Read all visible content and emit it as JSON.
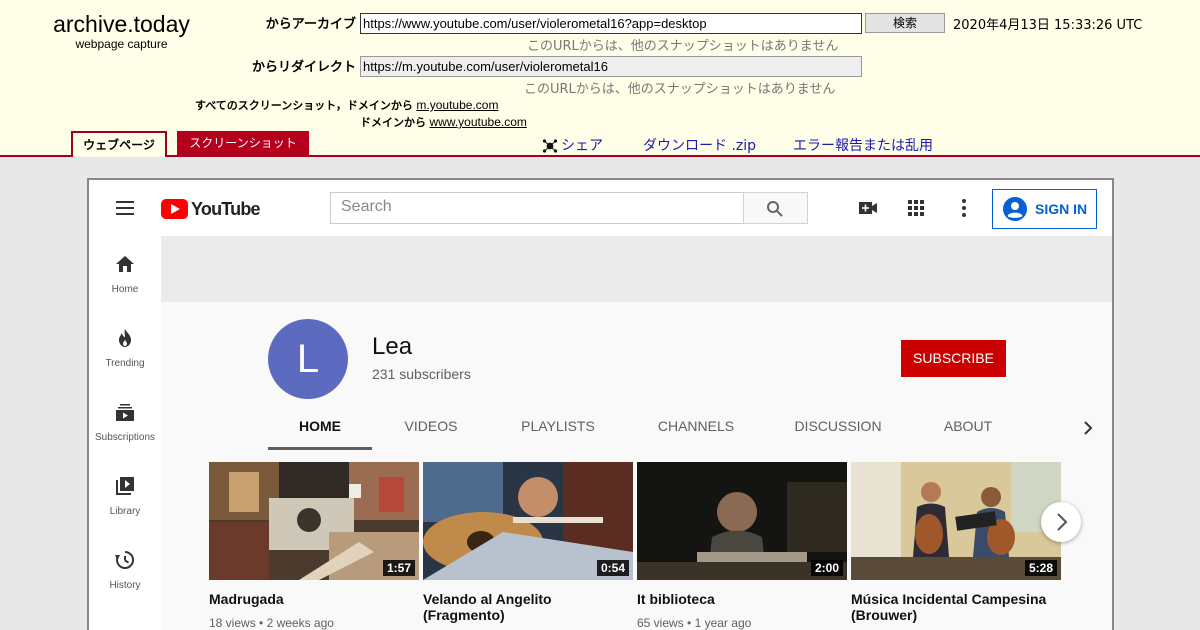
{
  "archive": {
    "brand_title": "archive.today",
    "brand_subtitle": "webpage capture",
    "archive_from_label": "からアーカイブ",
    "archive_url": "https://www.youtube.com/user/violerometal16?app=desktop",
    "search_button": "検索",
    "timestamp": "2020年4月13日 15:33:26 UTC",
    "no_snapshots_1": "このURLからは、他のスナップショットはありません",
    "redirect_label": "からリダイレクト",
    "redirect_url": "https://m.youtube.com/user/violerometal16",
    "no_snapshots_2": "このURLからは、他のスナップショットはありません",
    "all_screenshots_prefix": "すべてのスクリーンショット，ドメインから",
    "domain_1": "m.youtube.com",
    "domain_prefix_2": "ドメインから",
    "domain_2": "www.youtube.com",
    "tab_webpage": "ウェブページ",
    "tab_screenshot": "スクリーンショット",
    "share": "シェア",
    "download": "ダウンロード .zip",
    "report": "エラー報告または乱用"
  },
  "youtube": {
    "logo_text": "YouTube",
    "search_placeholder": "Search",
    "sign_in": "SIGN IN",
    "sidebar": [
      {
        "label": "Home",
        "icon": "home-icon"
      },
      {
        "label": "Trending",
        "icon": "flame-icon"
      },
      {
        "label": "Subscriptions",
        "icon": "subscriptions-icon"
      },
      {
        "label": "Library",
        "icon": "library-icon"
      },
      {
        "label": "History",
        "icon": "history-icon"
      }
    ],
    "channel": {
      "avatar_letter": "L",
      "name": "Lea",
      "subscribers": "231 subscribers",
      "subscribe_button": "SUBSCRIBE"
    },
    "tabs": [
      "HOME",
      "VIDEOS",
      "PLAYLISTS",
      "CHANNELS",
      "DISCUSSION",
      "ABOUT"
    ],
    "active_tab": "HOME",
    "videos": [
      {
        "title": "Madrugada",
        "duration": "1:57",
        "views": "18 views",
        "age": "2 weeks ago"
      },
      {
        "title": "Velando al Angelito (Fragmento)",
        "duration": "0:54",
        "views": "",
        "age": ""
      },
      {
        "title": "It biblioteca",
        "duration": "2:00",
        "views": "65 views",
        "age": "1 year ago"
      },
      {
        "title": "Música Incidental Campesina (Brouwer)",
        "duration": "5:28",
        "views": "",
        "age": ""
      }
    ],
    "colors": {
      "accent_red": "#cc0000",
      "link_blue": "#065fd4",
      "avatar": "#5c6bc0",
      "archive_bg": "#fffee9",
      "archive_red": "#a0001f"
    }
  }
}
